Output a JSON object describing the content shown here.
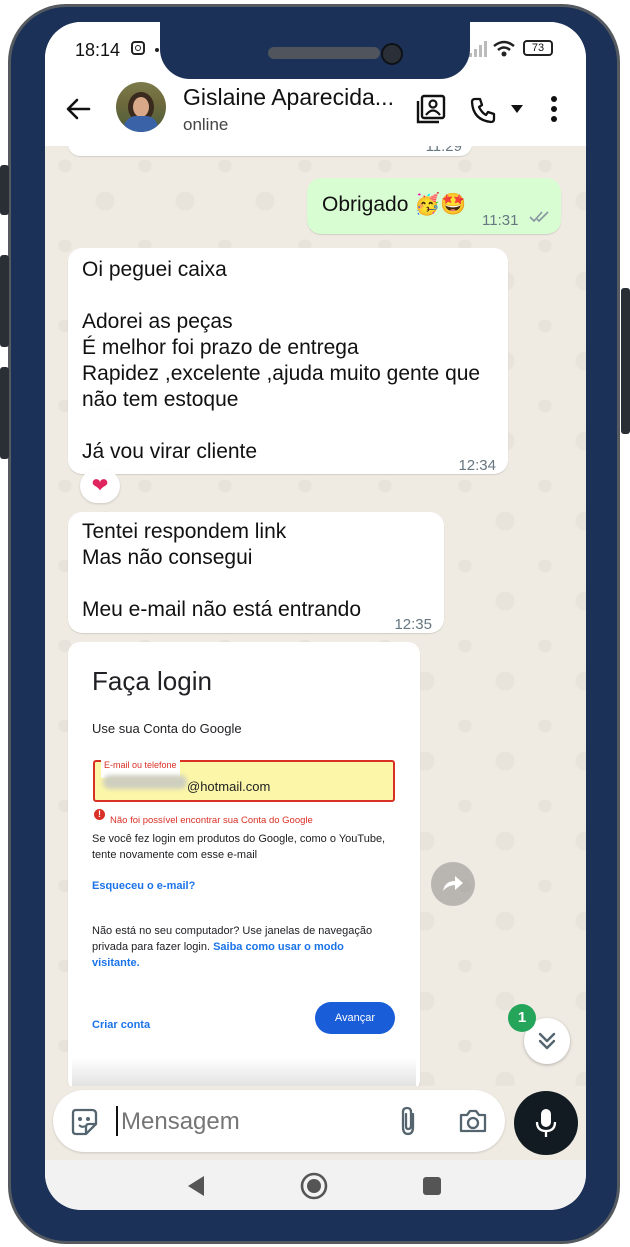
{
  "status": {
    "time": "18:14",
    "battery": "73"
  },
  "contact": {
    "name": "Gislaine Aparecida...",
    "status": "online"
  },
  "messages": {
    "prev_time": "11:29",
    "out_text": "Obrigado 🥳🤩",
    "out_time": "11:31",
    "msg1_lines": [
      "Oi peguei caixa",
      "",
      "Adorei as peças",
      "É melhor foi prazo de entrega",
      "Rapidez ,excelente ,ajuda muito gente que",
      "não tem estoque",
      "",
      "Já vou virar cliente"
    ],
    "msg1_time": "12:34",
    "reaction": "❤️",
    "msg2_lines": [
      "Tentei respondem link",
      "Mas não consegui",
      "",
      "Meu e-mail não está entrando"
    ],
    "msg2_time": "12:35"
  },
  "screenshot": {
    "title": "Faça login",
    "subtitle": "Use sua Conta do Google",
    "field_label": "E-mail ou telefone",
    "field_value": "@hotmail.com",
    "error": "Não foi possível encontrar sua Conta do Google",
    "info": "Se você fez login em produtos do Google, como o YouTube, tente novamente com esse e-mail",
    "forgot": "Esqueceu o e-mail?",
    "private_text": "Não está no seu computador? Use janelas de navegação privada para fazer login.",
    "private_link": "Saiba como usar o modo visitante.",
    "create": "Criar conta",
    "next": "Avançar"
  },
  "unread_count": "1",
  "composer": {
    "placeholder": "Mensagem"
  },
  "colors": {
    "frame": "#1b3158",
    "out_bubble": "#d9fdd3",
    "chat_bg": "#efeae2",
    "google_blue": "#1a73e8",
    "error_red": "#d93025"
  }
}
